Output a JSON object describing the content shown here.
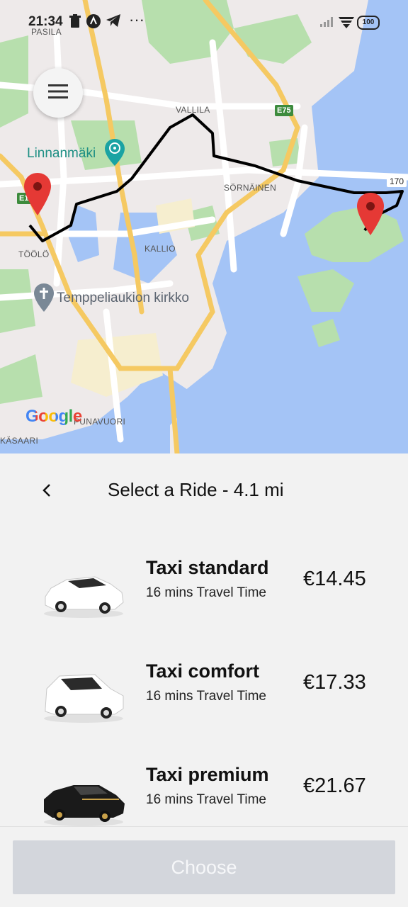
{
  "status_bar": {
    "time": "21:34",
    "battery": "100"
  },
  "map": {
    "labels": {
      "pasila": "PASILA",
      "vallila": "VALLILA",
      "sornainen": "SÖRNÄINEN",
      "kallio": "KALLIO",
      "toolo": "TÖÖLÖ",
      "punavuori": "PUNAVUORI",
      "kasaari": "KÄSAARI"
    },
    "pois": {
      "linnanmaki": "Linnanmäki",
      "temppeliaukion": "Temppeliaukion kirkko"
    },
    "road_shields": {
      "e75": "E75",
      "e12": "E12"
    },
    "road_number": "170",
    "attribution": "Google",
    "colors": {
      "water": "#a4c4f6",
      "park": "#b7dfad",
      "land": "#eeeaea",
      "road": "#ffffff",
      "highway": "#f5c962",
      "route": "#000000",
      "marker": "#e53935"
    }
  },
  "panel": {
    "title": "Select a Ride - 4.1 mi",
    "rides": [
      {
        "name": "Taxi standard",
        "time": "16 mins Travel Time",
        "price": "€14.45",
        "car_color": "white"
      },
      {
        "name": "Taxi comfort",
        "time": "16 mins Travel Time",
        "price": "€17.33",
        "car_color": "white"
      },
      {
        "name": "Taxi premium",
        "time": "16 mins Travel Time",
        "price": "€21.67",
        "car_color": "black"
      }
    ],
    "choose_label": "Choose"
  }
}
